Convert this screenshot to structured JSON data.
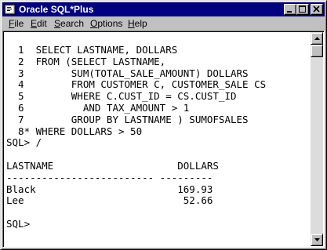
{
  "window": {
    "title": "Oracle SQL*Plus",
    "colors": {
      "titlebar": "#000080",
      "titletext": "#ffffff",
      "chrome": "#c0c0c0",
      "console_bg": "#ffffff"
    }
  },
  "titlebar": {
    "icons": [
      "sqlplus-app-icon",
      "minimize-icon",
      "maximize-icon",
      "close-icon"
    ]
  },
  "menu": [
    {
      "label": "File",
      "mnemonic": "F"
    },
    {
      "label": "Edit",
      "mnemonic": "E"
    },
    {
      "label": "Search",
      "mnemonic": "S"
    },
    {
      "label": "Options",
      "mnemonic": "O"
    },
    {
      "label": "Help",
      "mnemonic": "H"
    }
  ],
  "console": {
    "lines": [
      "  1  SELECT LASTNAME, DOLLARS",
      "  2  FROM (SELECT LASTNAME,",
      "  3        SUM(TOTAL_SALE_AMOUNT) DOLLARS",
      "  4        FROM CUSTOMER C, CUSTOMER_SALE CS",
      "  5        WHERE C.CUST_ID = CS.CUST_ID",
      "  6          AND TAX_AMOUNT > 1",
      "  7        GROUP BY LASTNAME ) SUMOFSALES",
      "  8* WHERE DOLLARS > 50",
      "SQL> /",
      "",
      "LASTNAME                     DOLLARS",
      "------------------------- ---------",
      "Black                        169.93",
      "Lee                           52.66",
      "",
      "SQL>"
    ]
  },
  "scrollbar": {
    "icons": [
      "scroll-up-arrow-icon",
      "scroll-down-arrow-icon"
    ],
    "position": 0
  }
}
